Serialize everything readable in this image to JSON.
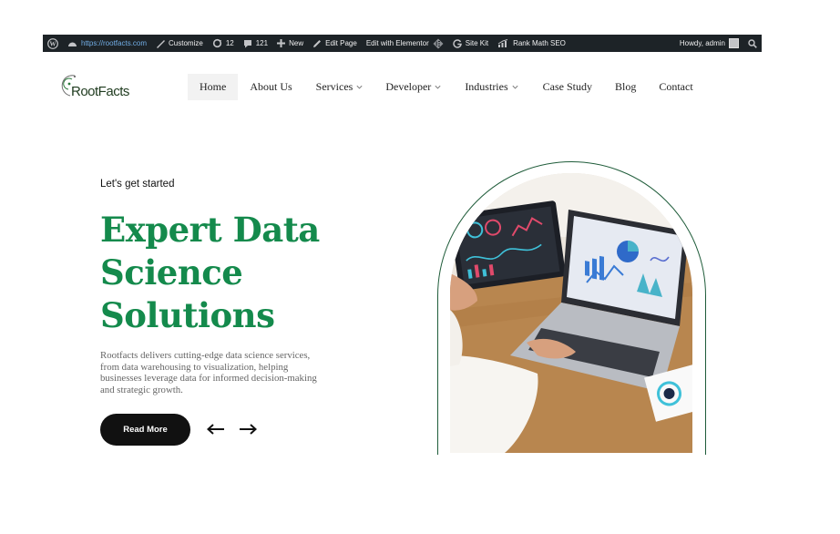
{
  "admin_bar": {
    "url": "https://rootfacts.com",
    "customize": "Customize",
    "updates_count": "12",
    "comments_count": "121",
    "new_label": "New",
    "edit_page": "Edit Page",
    "edit_elementor": "Edit with Elementor",
    "site_kit": "Site Kit",
    "rank_math": "Rank Math SEO",
    "howdy": "Howdy, admin"
  },
  "logo": {
    "text": "RootFacts"
  },
  "nav": {
    "items": [
      {
        "label": "Home",
        "active": true,
        "dropdown": false
      },
      {
        "label": "About Us",
        "dropdown": false
      },
      {
        "label": "Services",
        "dropdown": true
      },
      {
        "label": "Developer",
        "dropdown": true
      },
      {
        "label": "Industries",
        "dropdown": true
      },
      {
        "label": "Case Study",
        "dropdown": false
      },
      {
        "label": "Blog",
        "dropdown": false
      },
      {
        "label": "Contact",
        "dropdown": false
      }
    ]
  },
  "hero": {
    "eyebrow": "Let's get started",
    "title_lines": [
      "Expert Data",
      "Science",
      "Solutions"
    ],
    "description": "Rootfacts delivers cutting-edge data science services, from data warehousing to visualization, helping businesses leverage data for informed decision-making and strategic growth.",
    "cta_label": "Read More"
  },
  "colors": {
    "accent_green": "#148a4c",
    "admin_bar": "#1d2327",
    "arch_border": "#1f5c3a",
    "button": "#111111"
  },
  "icons": [
    "wordpress-icon",
    "dashboard-icon",
    "brush-icon",
    "updates-icon",
    "comment-icon",
    "plus-icon",
    "pencil-icon",
    "elementor-icon",
    "google-g-icon",
    "rank-math-icon",
    "search-icon",
    "arrow-left-icon",
    "arrow-right-icon",
    "chevron-down-icon"
  ]
}
